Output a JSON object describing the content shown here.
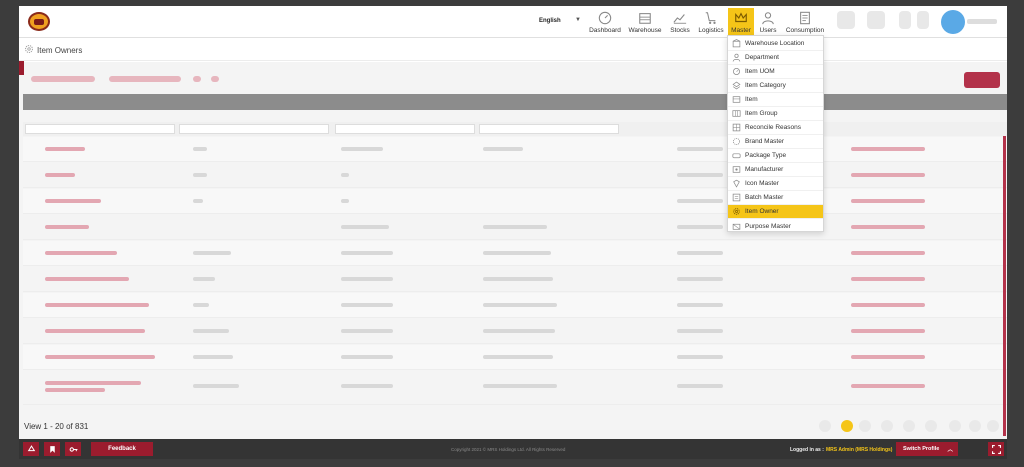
{
  "topbar": {
    "language": "English",
    "nav": [
      {
        "label": "Dashboard",
        "icon": "dashboard-icon"
      },
      {
        "label": "Warehouse",
        "icon": "warehouse-icon"
      },
      {
        "label": "Stocks",
        "icon": "stocks-icon"
      },
      {
        "label": "Logistics",
        "icon": "logistics-icon"
      },
      {
        "label": "Master",
        "icon": "crown-icon",
        "active": true
      },
      {
        "label": "Users",
        "icon": "user-icon"
      },
      {
        "label": "Consumption",
        "icon": "document-icon"
      }
    ]
  },
  "breadcrumb": {
    "title": "Item Owners"
  },
  "menu": {
    "items": [
      {
        "label": "Warehouse Location"
      },
      {
        "label": "Department"
      },
      {
        "label": "Item UOM"
      },
      {
        "label": "Item Category"
      },
      {
        "label": "Item"
      },
      {
        "label": "Item Group"
      },
      {
        "label": "Reconcile Reasons"
      },
      {
        "label": "Brand Master"
      },
      {
        "label": "Package Type"
      },
      {
        "label": "Manufacturer"
      },
      {
        "label": "Icon Master"
      },
      {
        "label": "Batch Master"
      },
      {
        "label": "Item Owner",
        "active": true
      },
      {
        "label": "Purpose Master"
      }
    ]
  },
  "grid": {
    "view_count": "View 1 - 20 of 831"
  },
  "footer": {
    "feedback": "Feedback",
    "copyright": "Copyright 2021 © MRS Holdings Ltd. All Rights Reserved",
    "logged_in_label": "Logged in as :",
    "logged_in_user": "MRS Admin (MRS Holdings)",
    "switch_profile": "Switch Profile"
  },
  "colors": {
    "accent": "#9b1c2e",
    "highlight": "#f5c518",
    "footer_bg": "#343434"
  }
}
